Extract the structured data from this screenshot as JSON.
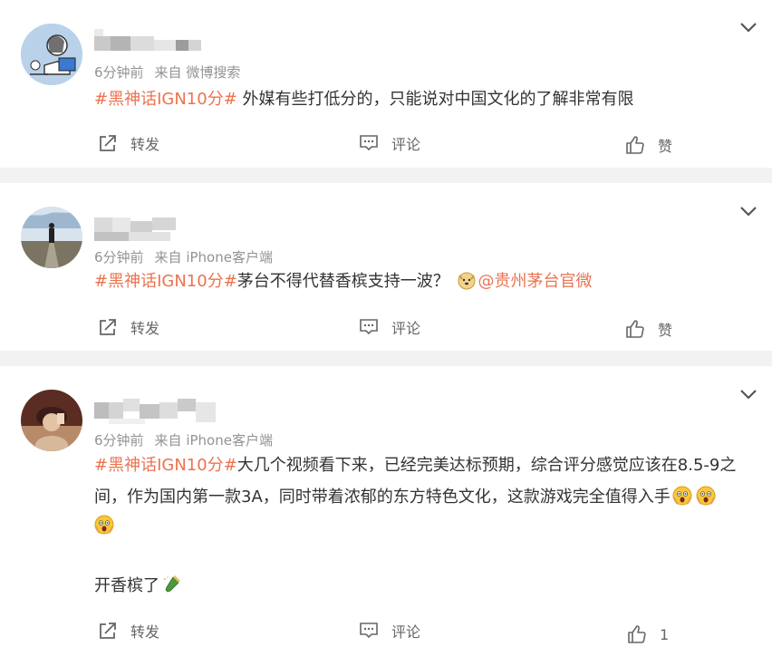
{
  "posts": [
    {
      "meta": {
        "time": "6分钟前",
        "source": "来自 微博搜索"
      },
      "content": {
        "topic": "#黑神话IGN10分#",
        "text": " 外媒有些打低分的，只能说对中国文化的了解非常有限"
      },
      "actions": {
        "repost": "转发",
        "comment": "评论",
        "like": "赞"
      }
    },
    {
      "meta": {
        "time": "6分钟前",
        "source": "来自 iPhone客户端"
      },
      "content": {
        "topic": "#黑神话IGN10分#",
        "text": "茅台不得代替香槟支持一波？",
        "emoji": "doge-emoji",
        "mention": "@贵州茅台官微"
      },
      "actions": {
        "repost": "转发",
        "comment": "评论",
        "like": "赞"
      }
    },
    {
      "meta": {
        "time": "6分钟前",
        "source": "来自 iPhone客户端"
      },
      "content": {
        "topic": "#黑神话IGN10分#",
        "text_line1": "大几个视频看下来，已经完美达标预期，综合评分感觉应该在8.5-9之",
        "text_line2": "间，作为国内第一款3A，同时带着浓郁的东方特色文化，这款游戏完全值得入手",
        "text_line4": "开香槟了",
        "emojis": [
          "screaming-face-emoji",
          "screaming-face-emoji",
          "screaming-face-emoji",
          "champagne-emoji"
        ]
      },
      "actions": {
        "repost": "转发",
        "comment": "评论",
        "like": "1"
      }
    }
  ],
  "colors": {
    "topic": "#eb7350",
    "meta": "#939393",
    "text": "#333333",
    "background": "#f2f2f2"
  }
}
